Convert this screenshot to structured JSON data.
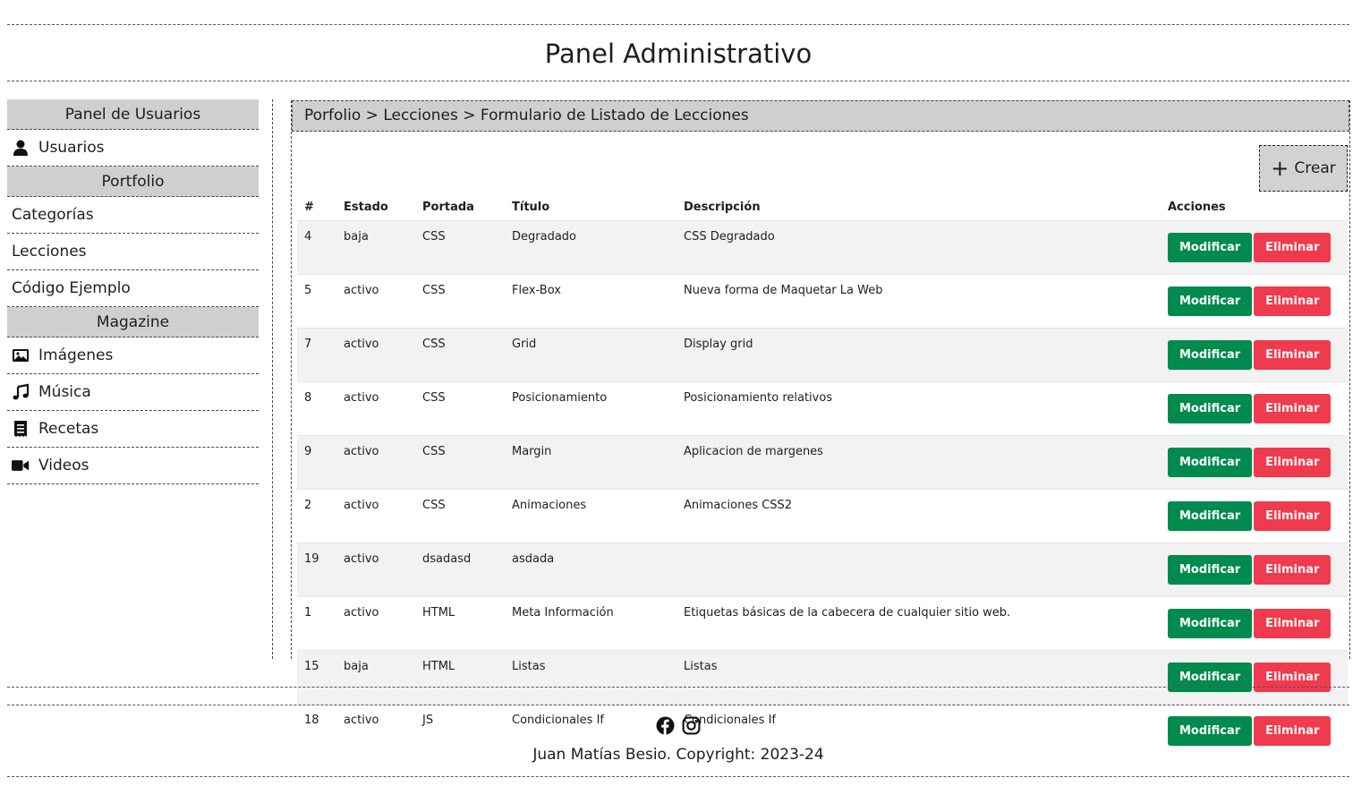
{
  "header": {
    "title": "Panel Administrativo"
  },
  "sidebar": {
    "sections": [
      {
        "title": "Panel de Usuarios",
        "items": [
          {
            "label": "Usuarios",
            "icon": "user-icon"
          }
        ]
      },
      {
        "title": "Portfolio",
        "items": [
          {
            "label": "Categorías"
          },
          {
            "label": "Lecciones"
          },
          {
            "label": "Código Ejemplo"
          }
        ]
      },
      {
        "title": "Magazine",
        "items": [
          {
            "label": "Imágenes",
            "icon": "image-icon"
          },
          {
            "label": "Música",
            "icon": "music-icon"
          },
          {
            "label": "Recetas",
            "icon": "receipt-icon"
          },
          {
            "label": "Videos",
            "icon": "video-icon"
          }
        ]
      }
    ]
  },
  "breadcrumb": "Porfolio > Lecciones > Formulario de Listado de Lecciones",
  "create_button": {
    "label": "Crear",
    "icon": "plus-icon"
  },
  "table": {
    "headers": [
      "#",
      "Estado",
      "Portada",
      "Título",
      "Descripción",
      "Acciones"
    ],
    "modify_label": "Modificar",
    "delete_label": "Eliminar",
    "rows": [
      {
        "id": "4",
        "estado": "baja",
        "portada": "CSS",
        "titulo": "Degradado",
        "descripcion": "CSS Degradado"
      },
      {
        "id": "5",
        "estado": "activo",
        "portada": "CSS",
        "titulo": "Flex-Box",
        "descripcion": "Nueva forma de Maquetar La Web"
      },
      {
        "id": "7",
        "estado": "activo",
        "portada": "CSS",
        "titulo": "Grid",
        "descripcion": "Display grid"
      },
      {
        "id": "8",
        "estado": "activo",
        "portada": "CSS",
        "titulo": "Posicionamiento",
        "descripcion": "Posicionamiento relativos"
      },
      {
        "id": "9",
        "estado": "activo",
        "portada": "CSS",
        "titulo": "Margin",
        "descripcion": "Aplicacion de margenes"
      },
      {
        "id": "2",
        "estado": "activo",
        "portada": "CSS",
        "titulo": "Animaciones",
        "descripcion": "Animaciones CSS2"
      },
      {
        "id": "19",
        "estado": "activo",
        "portada": "dsadasd",
        "titulo": "asdada",
        "descripcion": ""
      },
      {
        "id": "1",
        "estado": "activo",
        "portada": "HTML",
        "titulo": "Meta Información",
        "descripcion": "Etiquetas básicas de la cabecera de cualquier sitio web."
      },
      {
        "id": "15",
        "estado": "baja",
        "portada": "HTML",
        "titulo": "Listas",
        "descripcion": "Listas"
      },
      {
        "id": "18",
        "estado": "activo",
        "portada": "JS",
        "titulo": "Condicionales If",
        "descripcion": "Condicionales If"
      }
    ]
  },
  "footer": {
    "icons": [
      "facebook-icon",
      "instagram-icon"
    ],
    "copyright": "Juan Matías Besio. Copyright: 2023-24"
  },
  "colors": {
    "modify": "#008a4e",
    "delete": "#f03a4d",
    "section_bg": "#cfcfcf"
  }
}
